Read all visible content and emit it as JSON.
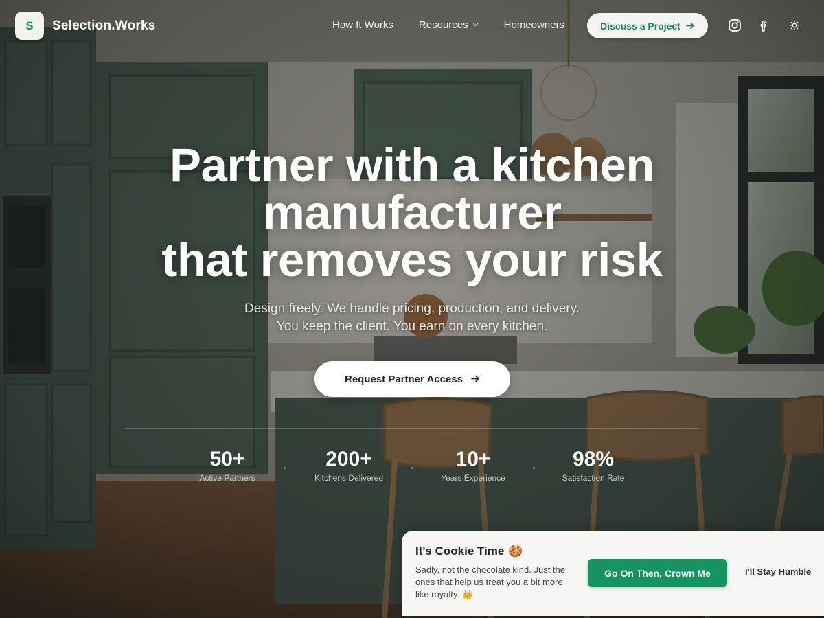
{
  "brand": {
    "mark": "S",
    "name": "Selection.Works"
  },
  "nav": {
    "items": [
      {
        "label": "How It Works"
      },
      {
        "label": "Resources",
        "has_dropdown": true
      },
      {
        "label": "Homeowners"
      }
    ],
    "cta_label": "Discuss a Project"
  },
  "header_icons": [
    "instagram-icon",
    "facebook-icon",
    "theme-toggle-icon"
  ],
  "hero": {
    "title_lines": [
      "Partner with a kitchen",
      "manufacturer",
      "that removes your risk"
    ],
    "subtitle_lines": [
      "Design freely. We handle pricing, production, and delivery.",
      "You keep the client. You earn on every kitchen."
    ],
    "cta_label": "Request Partner Access"
  },
  "stats": [
    {
      "value": "50+",
      "label": "Active Partners"
    },
    {
      "value": "200+",
      "label": "Kitchens Delivered"
    },
    {
      "value": "10+",
      "label": "Years Experience"
    },
    {
      "value": "98%",
      "label": "Satisfaction Rate"
    }
  ],
  "cookie_banner": {
    "title": "It's Cookie Time",
    "title_emoji": "🍪",
    "text": "Sadly, not the chocolate kind. Just the ones that help us treat you a bit more like royalty. 👑",
    "accept_label": "Go On Then, Crown Me",
    "decline_label": "I'll Stay Humble"
  },
  "colors": {
    "accent": "#15945f",
    "accent_text": "#198a5c",
    "cabinet": "#4e6357"
  }
}
